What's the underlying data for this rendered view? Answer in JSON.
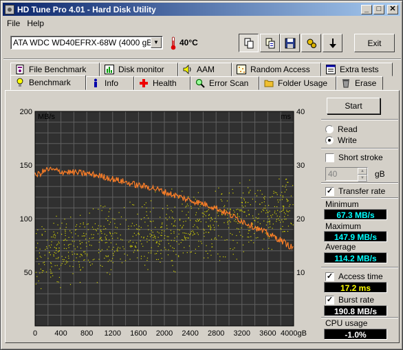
{
  "window": {
    "title": "HD Tune Pro 4.01 - Hard Disk Utility"
  },
  "window_controls": {
    "minimize": "_",
    "maximize": "□",
    "close": "✕"
  },
  "menu": {
    "items": [
      "File",
      "Help"
    ]
  },
  "toolbar": {
    "drive": "ATA    WDC WD40EFRX-68W (4000 gB)",
    "temperature": "40°C",
    "exit_label": "Exit",
    "buttons": [
      "copy-icon",
      "copy-info-icon",
      "save-icon",
      "options-icon",
      "download-icon"
    ]
  },
  "tabs_row1": [
    {
      "label": "File Benchmark",
      "icon": "file-benchmark-icon"
    },
    {
      "label": "Disk monitor",
      "icon": "disk-monitor-icon"
    },
    {
      "label": "AAM",
      "icon": "speaker-icon"
    },
    {
      "label": "Random Access",
      "icon": "random-access-icon"
    },
    {
      "label": "Extra tests",
      "icon": "extra-tests-icon"
    }
  ],
  "tabs_row2": [
    {
      "label": "Benchmark",
      "icon": "lightbulb-icon",
      "active": true
    },
    {
      "label": "Info",
      "icon": "info-icon"
    },
    {
      "label": "Health",
      "icon": "health-cross-icon"
    },
    {
      "label": "Error Scan",
      "icon": "magnifier-icon"
    },
    {
      "label": "Folder Usage",
      "icon": "folder-icon"
    },
    {
      "label": "Erase",
      "icon": "trash-icon"
    }
  ],
  "controls": {
    "start_label": "Start",
    "read_label": "Read",
    "write_label": "Write",
    "mode_selected": "Write",
    "short_stroke_label": "Short stroke",
    "short_stroke_checked": false,
    "short_stroke_value": "40",
    "short_stroke_unit": "gB",
    "transfer_rate_label": "Transfer rate",
    "transfer_rate_checked": true,
    "access_time_label": "Access time",
    "access_time_checked": true,
    "burst_rate_label": "Burst rate",
    "burst_rate_checked": true
  },
  "results": {
    "minimum_label": "Minimum",
    "minimum_value": "67.3 MB/s",
    "maximum_label": "Maximum",
    "maximum_value": "147.9 MB/s",
    "average_label": "Average",
    "average_value": "114.2 MB/s",
    "access_time_value": "17.2 ms",
    "burst_rate_value": "190.8 MB/s",
    "cpu_usage_label": "CPU usage",
    "cpu_usage_value": "-1.0%"
  },
  "chart_data": {
    "type": "line",
    "y_left_label": "MB/s",
    "y_right_label": "ms",
    "y_left_ticks": [
      "200",
      "150",
      "100",
      "50"
    ],
    "y_right_ticks": [
      "40",
      "30",
      "20",
      "10"
    ],
    "x_ticks": [
      "0",
      "400",
      "800",
      "1200",
      "1600",
      "2000",
      "2400",
      "2800",
      "3200",
      "3600",
      "4000gB"
    ],
    "xlim": [
      0,
      4000
    ],
    "ylim_left": [
      0,
      200
    ],
    "ylim_right": [
      0,
      40
    ],
    "grid": true,
    "colors": {
      "transfer": "#ff7f27",
      "access": "#d8d800",
      "background": "#303030",
      "grid": "#606060"
    },
    "series": [
      {
        "x": [
          0,
          200,
          400,
          600,
          800,
          1000,
          1200,
          1400,
          1600,
          1800,
          2000,
          2200,
          2400,
          2600,
          2800,
          3000,
          3200,
          3400,
          3600,
          3800,
          4000
        ],
        "values": [
          140,
          146,
          144,
          143,
          142,
          140,
          137,
          134,
          131,
          129,
          125,
          121,
          117,
          114,
          110,
          104,
          98,
          92,
          86,
          80,
          72
        ]
      },
      {
        "x": [
          0,
          400,
          800,
          1200,
          1600,
          2000,
          2400,
          2800,
          3200,
          3600,
          4000
        ],
        "values": [
          13,
          14,
          15,
          16,
          17,
          17.5,
          18.5,
          19,
          20,
          21,
          22
        ]
      }
    ]
  }
}
